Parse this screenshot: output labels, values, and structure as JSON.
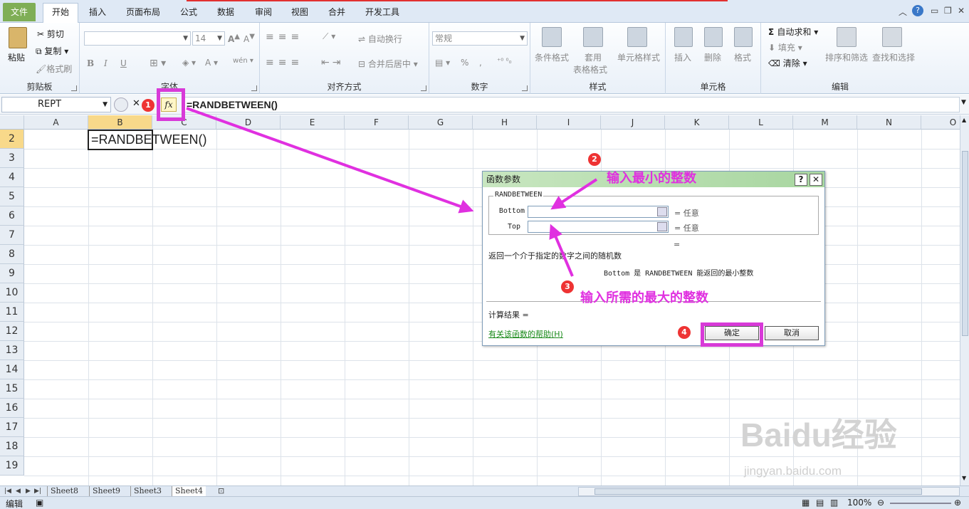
{
  "tabs": [
    "文件",
    "开始",
    "插入",
    "页面布局",
    "公式",
    "数据",
    "审阅",
    "视图",
    "合并",
    "开发工具"
  ],
  "ribbon": {
    "clipboard": {
      "label": "剪贴板",
      "paste": "粘贴",
      "cut": "剪切",
      "copy": "复制",
      "format_painter": "格式刷"
    },
    "font": {
      "label": "字体",
      "size": "14",
      "bold": "B",
      "italic": "I",
      "underline": "U"
    },
    "align": {
      "label": "对齐方式",
      "wrap": "自动换行",
      "merge": "合并后居中"
    },
    "number": {
      "label": "数字",
      "format": "常规"
    },
    "styles": {
      "label": "样式",
      "conditional": "条件格式",
      "table1": "套用",
      "table2": "表格格式",
      "cell_style": "单元格样式"
    },
    "cells": {
      "label": "单元格",
      "insert": "插入",
      "delete": "删除",
      "format": "格式"
    },
    "editing": {
      "label": "编辑",
      "autosum": "自动求和",
      "fill": "填充",
      "clear": "清除",
      "sort": "排序和筛选",
      "find": "查找和选择"
    }
  },
  "formula_bar": {
    "name_box": "REPT",
    "fx": "fx",
    "formula": "=RANDBETWEEN()"
  },
  "grid": {
    "columns": [
      "A",
      "B",
      "C",
      "D",
      "E",
      "F",
      "G",
      "H",
      "I",
      "J",
      "K",
      "L",
      "M",
      "N",
      "O"
    ],
    "rows": [
      "2",
      "3",
      "4",
      "5",
      "6",
      "7",
      "8",
      "9",
      "10",
      "11",
      "12",
      "13",
      "14",
      "15",
      "16",
      "17",
      "18",
      "19"
    ],
    "active_cell_value": "=RANDBETWEEN()"
  },
  "sheets": [
    "Sheet8",
    "Sheet9",
    "Sheet3",
    "Sheet4"
  ],
  "status": {
    "mode": "编辑",
    "zoom": "100%"
  },
  "dialog": {
    "title": "函数参数",
    "help_btn": "?",
    "close_btn": "✕",
    "func_name": "RANDBETWEEN",
    "arg1": "Bottom",
    "arg2": "Top",
    "arg_result": "= 任意",
    "func_result": "=",
    "description": "返回一个介于指定的数字之间的随机数",
    "arg_desc": "Bottom  是 RANDBETWEEN 能返回的最小整数",
    "calc_result": "计算结果 =",
    "help_link": "有关该函数的帮助(H)",
    "ok": "确定",
    "cancel": "取消"
  },
  "annotations": {
    "step2": "输入最小的整数",
    "step3": "输入所需的最大的整数",
    "badges": [
      "1",
      "2",
      "3",
      "4"
    ]
  },
  "watermark": {
    "logo": "Baidu经验",
    "url": "jingyan.baidu.com"
  },
  "colors": {
    "highlight": "#d83ad8",
    "file_tab": "#7fae56",
    "badge": "#e33333"
  }
}
